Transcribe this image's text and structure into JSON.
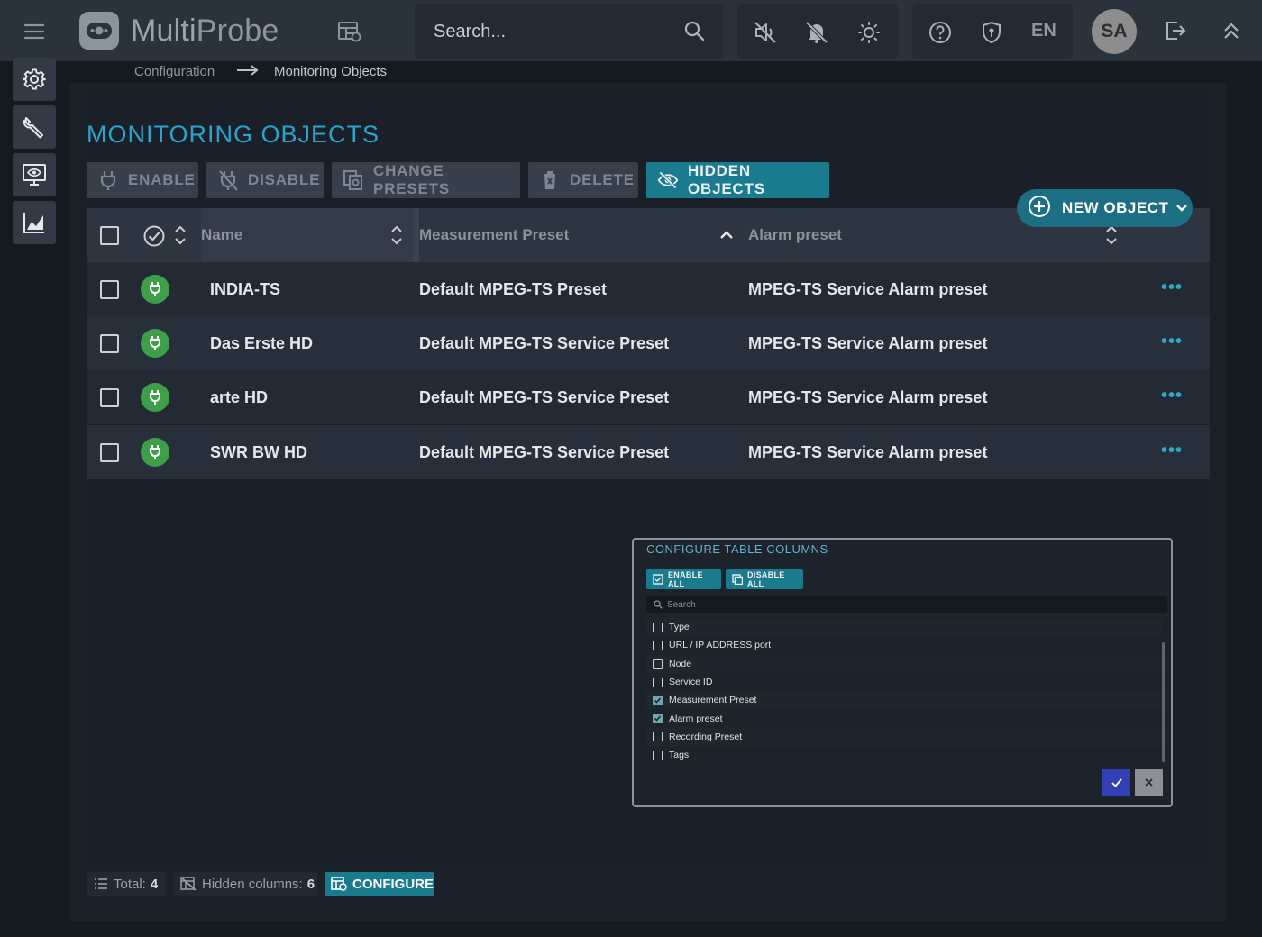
{
  "app": {
    "brand_bold": "Multi",
    "brand_light": "Probe"
  },
  "search": {
    "placeholder": "Search..."
  },
  "header": {
    "language": "EN",
    "user_initials": "SA"
  },
  "breadcrumb": {
    "parent": "Configuration",
    "current": "Monitoring Objects"
  },
  "page": {
    "title": "MONITORING OBJECTS"
  },
  "toolbar": {
    "enable": "ENABLE",
    "disable": "DISABLE",
    "change_presets": "CHANGE PRESETS",
    "delete": "DELETE",
    "hidden_objects": "HIDDEN OBJECTS",
    "new_object": "NEW OBJECT"
  },
  "table": {
    "columns": {
      "name": "Name",
      "measurement_preset": "Measurement Preset",
      "alarm_preset": "Alarm preset"
    },
    "rows": [
      {
        "name": "INDIA-TS",
        "measurement_preset": "Default MPEG-TS Preset",
        "alarm_preset": "MPEG-TS Service Alarm preset"
      },
      {
        "name": "Das Erste HD",
        "measurement_preset": "Default MPEG-TS Service Preset",
        "alarm_preset": "MPEG-TS Service Alarm preset"
      },
      {
        "name": "arte HD",
        "measurement_preset": "Default MPEG-TS Service Preset",
        "alarm_preset": "MPEG-TS Service Alarm preset"
      },
      {
        "name": "SWR BW HD",
        "measurement_preset": "Default MPEG-TS Service Preset",
        "alarm_preset": "MPEG-TS Service Alarm preset"
      }
    ],
    "row_menu": "•••"
  },
  "footer": {
    "total_label": "Total:",
    "total_value": "4",
    "hidden_label": "Hidden columns:",
    "hidden_value": "6",
    "configure": "CONFIGURE"
  },
  "dialog": {
    "title": "CONFIGURE TABLE COLUMNS",
    "enable_all": "ENABLE ALL",
    "disable_all": "DISABLE ALL",
    "search_placeholder": "Search",
    "options": [
      {
        "label": "Type",
        "checked": false
      },
      {
        "label": "URL / IP ADDRESS port",
        "checked": false
      },
      {
        "label": "Node",
        "checked": false
      },
      {
        "label": "Service ID",
        "checked": false
      },
      {
        "label": "Measurement Preset",
        "checked": true
      },
      {
        "label": "Alarm preset",
        "checked": true
      },
      {
        "label": "Recording Preset",
        "checked": false
      },
      {
        "label": "Tags",
        "checked": false
      }
    ]
  },
  "colors": {
    "accent": "#29a4cc",
    "primary_button": "#1a7a8e",
    "status_enabled": "#3f9e4a",
    "dialog_confirm": "#3340b5"
  },
  "icons": {
    "menu": "hamburger-icon",
    "logo": "multiprobe-logo-icon",
    "dashboard": "dashboard-grid-icon",
    "search": "search-icon",
    "sound": "volume-mute-icon",
    "notifications": "bell-off-icon",
    "theme": "brightness-icon",
    "help": "help-circle-icon",
    "security": "shield-icon",
    "logout": "logout-icon",
    "collapse": "chevrons-up-icon"
  }
}
